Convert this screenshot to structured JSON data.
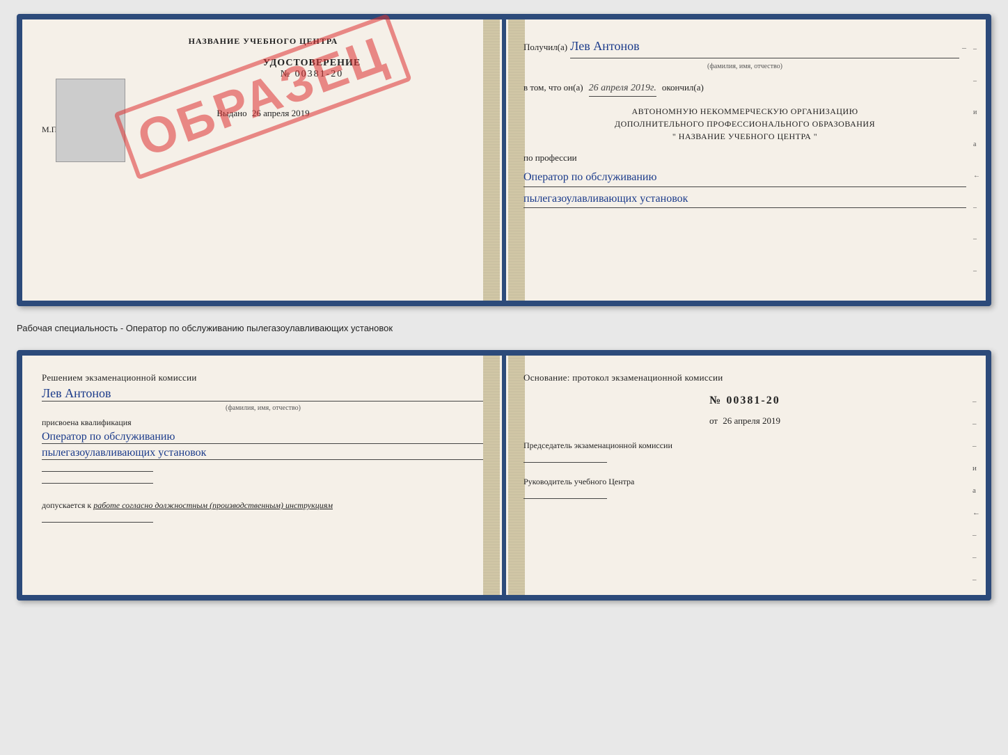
{
  "page": {
    "background": "#e8e8e8"
  },
  "top_cert": {
    "left": {
      "header": "НАЗВАНИЕ УЧЕБНОГО ЦЕНТРА",
      "title": "УДОСТОВЕРЕНИЕ",
      "number": "№ 00381-20",
      "vydano_label": "Выдано",
      "vydano_date": "26 апреля 2019",
      "mp": "М.П.",
      "obrazec": "ОБРАЗЕЦ"
    },
    "right": {
      "poluchil_label": "Получил(а)",
      "name": "Лев Антонов",
      "fio_sub": "(фамилия, имя, отчество)",
      "dash": "–",
      "vtom_label": "в том, что он(а)",
      "date_italic": "26 апреля 2019г.",
      "okoncil_label": "окончил(а)",
      "org_line1": "АВТОНОМНУЮ НЕКОММЕРЧЕСКУЮ ОРГАНИЗАЦИЮ",
      "org_line2": "ДОПОЛНИТЕЛЬНОГО ПРОФЕССИОНАЛЬНОГО ОБРАЗОВАНИЯ",
      "org_line3": "\"  НАЗВАНИЕ УЧЕБНОГО ЦЕНТРА  \"",
      "po_professii": "по профессии",
      "profession_line1": "Оператор по обслуживанию",
      "profession_line2": "пылегазоулавливающих установок",
      "side_chars": [
        "–",
        "–",
        "и",
        "а",
        "←",
        "–",
        "–",
        "–"
      ]
    }
  },
  "middle": {
    "text": "Рабочая специальность - Оператор по обслуживанию пылегазоулавливающих установок"
  },
  "bottom_cert": {
    "left": {
      "resheniem_label": "Решением экзаменационной комиссии",
      "name": "Лев Антонов",
      "fio_sub": "(фамилия, имя, отчество)",
      "prisvoyena": "присвоена квалификация",
      "qual_line1": "Оператор по обслуживанию",
      "qual_line2": "пылегазоулавливающих установок",
      "dopuskaetsya_prefix": "допускается к",
      "dopuskaetsya_text": "работе согласно должностным (производственным) инструкциям"
    },
    "right": {
      "osnovanie_label": "Основание: протокол экзаменационной комиссии",
      "number": "№  00381-20",
      "ot_label": "от",
      "ot_date": "26 апреля 2019",
      "predsedatel_label": "Председатель экзаменационной комиссии",
      "rukovoditel_label": "Руководитель учебного Центра",
      "side_chars": [
        "–",
        "–",
        "–",
        "и",
        "а",
        "←",
        "–",
        "–",
        "–"
      ]
    }
  }
}
